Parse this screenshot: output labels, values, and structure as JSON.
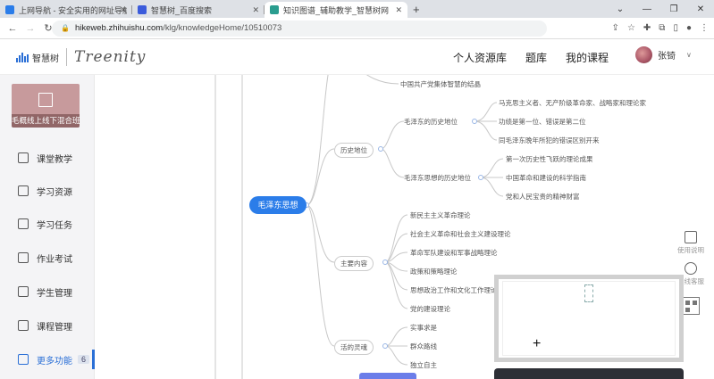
{
  "browser": {
    "tabs": [
      {
        "title": "上网导航 - 安全实用的网址导航",
        "favicon_color": "#2b7de9"
      },
      {
        "title": "智慧树_百度搜索",
        "favicon_color": "#3b5bdb"
      },
      {
        "title": "知识图谱_辅助教学_智慧树网",
        "favicon_color": "#2a9d8f"
      }
    ],
    "url_domain": "hikeweb.zhihuishu.com",
    "url_path": "/klg/knowledgeHome/10510073"
  },
  "header": {
    "logo_cn": "智慧树",
    "logo_en": "Treenity",
    "nav": [
      "个人资源库",
      "题库",
      "我的课程"
    ],
    "username": "张锜"
  },
  "sidebar": {
    "course_title": "毛概线上线下混合班...",
    "items": [
      {
        "label": "课堂教学",
        "icon": "classroom-icon"
      },
      {
        "label": "学习资源",
        "icon": "resource-icon"
      },
      {
        "label": "学习任务",
        "icon": "task-icon"
      },
      {
        "label": "作业考试",
        "icon": "exam-icon"
      },
      {
        "label": "学生管理",
        "icon": "student-icon"
      },
      {
        "label": "课程管理",
        "icon": "course-manage-icon"
      },
      {
        "label": "更多功能",
        "icon": "more-icon",
        "badge": "6",
        "active": true
      }
    ]
  },
  "mindmap": {
    "root": "毛泽东思想",
    "top_partial": "中国共产党集体智慧的结晶",
    "branches": [
      {
        "label": "历史地位",
        "children": [
          {
            "label": "毛泽东的历史地位",
            "children": [
              "马克思主义者、无产阶级革命家、战略家和理论家",
              "功绩是第一位、错误是第二位",
              "同毛泽东晚年所犯的错误区别开来"
            ]
          },
          {
            "label": "毛泽东思想的历史地位",
            "children": [
              "第一次历史性飞跃的理论成果",
              "中国革命和建设的科学指南",
              "党和人民宝贵的精神财富"
            ]
          }
        ]
      },
      {
        "label": "主要内容",
        "children": [
          "新民主主义革命理论",
          "社会主义革命和社会主义建设理论",
          "革命军队建设和军事战略理论",
          "政策和策略理论",
          "思想政治工作和文化工作理论",
          "党的建设理论"
        ]
      },
      {
        "label": "活的灵魂",
        "children": [
          "实事求是",
          "群众路线",
          "独立自主"
        ]
      }
    ]
  },
  "float_tools": {
    "help": "使用说明",
    "service": "在线客服"
  },
  "colors": {
    "accent": "#2b7de9",
    "line": "#c8c8c8"
  }
}
